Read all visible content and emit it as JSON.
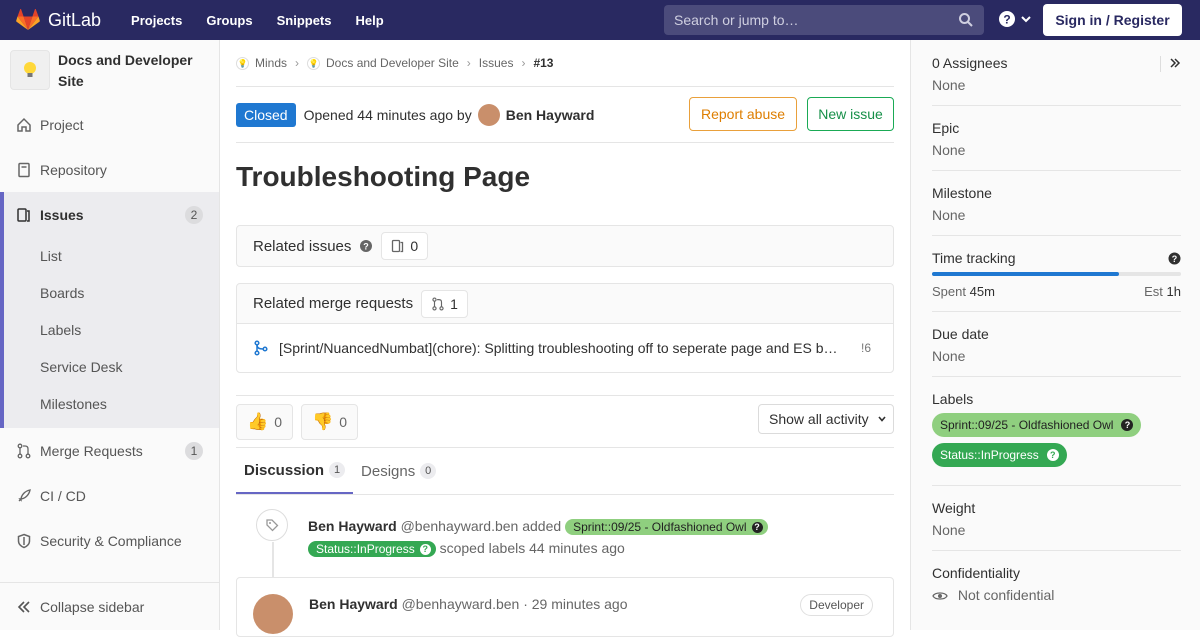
{
  "navbar": {
    "brand": "GitLab",
    "links": [
      "Projects",
      "Groups",
      "Snippets",
      "Help"
    ],
    "search_placeholder": "Search or jump to…",
    "signin": "Sign in / Register"
  },
  "sidebar": {
    "project_name": "Docs and Developer Site",
    "items": [
      {
        "label": "Project",
        "icon": "home-icon"
      },
      {
        "label": "Repository",
        "icon": "doc-icon"
      },
      {
        "label": "Issues",
        "icon": "issues-icon",
        "count": "2"
      },
      {
        "label": "Merge Requests",
        "icon": "merge-request-icon",
        "count": "1"
      },
      {
        "label": "CI / CD",
        "icon": "rocket-icon"
      },
      {
        "label": "Security & Compliance",
        "icon": "shield-icon"
      }
    ],
    "sub_items": [
      "List",
      "Boards",
      "Labels",
      "Service Desk",
      "Milestones"
    ],
    "collapse": "Collapse sidebar"
  },
  "breadcrumbs": [
    "Minds",
    "Docs and Developer Site",
    "Issues",
    "#13"
  ],
  "issue": {
    "status": "Closed",
    "opened_text": "Opened 44 minutes ago by",
    "author": "Ben Hayward",
    "report_abuse": "Report abuse",
    "new_issue": "New issue",
    "title": "Troubleshooting Page"
  },
  "related_issues": {
    "label": "Related issues",
    "count": "0"
  },
  "related_mrs": {
    "label": "Related merge requests",
    "count": "1",
    "item_title": "[Sprint/NuancedNumbat](chore): Splitting troubleshooting off to seperate page and ES b…",
    "item_ref": "!6"
  },
  "awards": {
    "thumbsup": "0",
    "thumbsdown": "0"
  },
  "activity_filter": "Show all activity",
  "tabs": [
    {
      "label": "Discussion",
      "count": "1"
    },
    {
      "label": "Designs",
      "count": "0"
    }
  ],
  "system_note": {
    "author": "Ben Hayward",
    "handle": "@benhayward.ben",
    "action": "added",
    "label1": "Sprint::09/25 - Oldfashioned Owl",
    "label2": "Status::InProgress",
    "suffix": "scoped labels 44 minutes ago"
  },
  "comment": {
    "author": "Ben Hayward",
    "meta": "@benhayward.ben · 29 minutes ago",
    "role": "Developer"
  },
  "right_sidebar": {
    "assignees_label": "0 Assignees",
    "assignees_value": "None",
    "epic_label": "Epic",
    "epic_value": "None",
    "milestone_label": "Milestone",
    "milestone_value": "None",
    "time_label": "Time tracking",
    "time_spent_label": "Spent",
    "time_spent": "45m",
    "time_est_label": "Est",
    "time_est": "1h",
    "time_progress": 0.75,
    "due_label": "Due date",
    "due_value": "None",
    "labels_label": "Labels",
    "labels": [
      "Sprint::09/25 - Oldfashioned Owl",
      "Status::InProgress"
    ],
    "weight_label": "Weight",
    "weight_value": "None",
    "conf_label": "Confidentiality",
    "conf_value": "Not confidential"
  },
  "colors": {
    "navbar": "#292961",
    "accent": "#6666c4",
    "status_closed": "#1f78d1",
    "label_sprint": "#8fcf7f",
    "label_status": "#34a853"
  }
}
